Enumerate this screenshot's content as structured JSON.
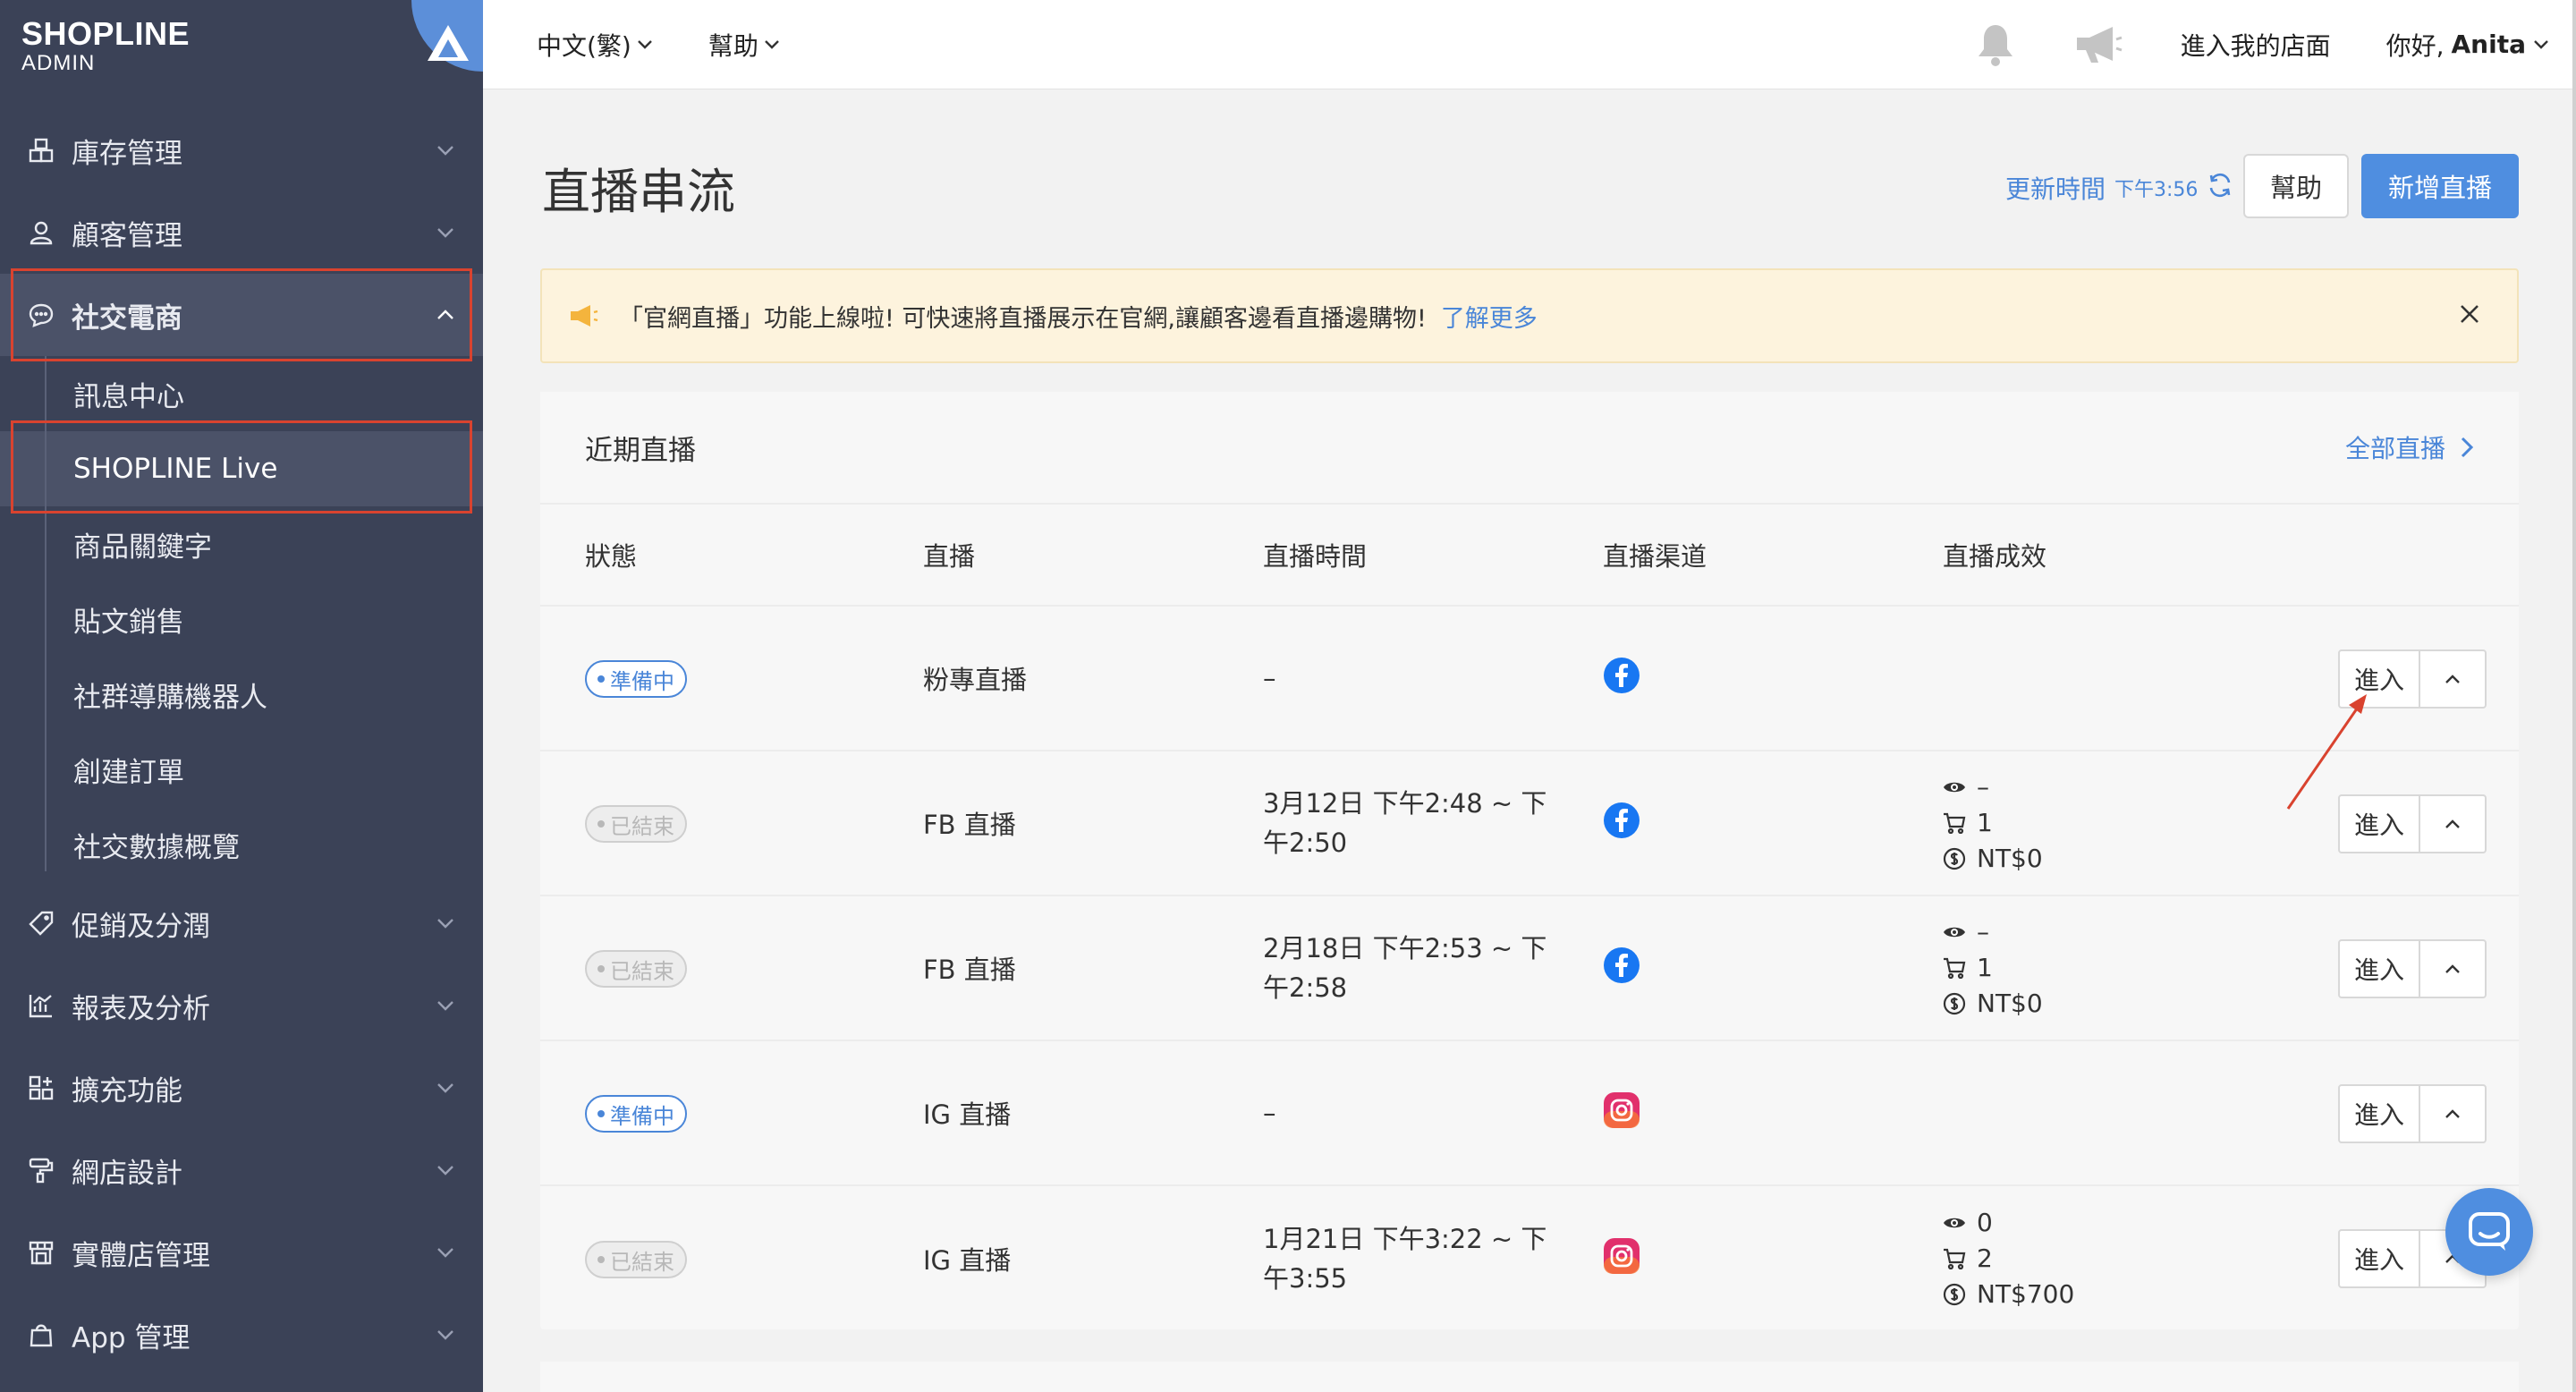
{
  "brand": {
    "name": "SHOPLINE",
    "sub": "ADMIN"
  },
  "sidebar": {
    "items": [
      {
        "label": "庫存管理",
        "icon": "inventory-icon"
      },
      {
        "label": "顧客管理",
        "icon": "user-icon"
      },
      {
        "label": "社交電商",
        "icon": "chat-icon",
        "expanded": true
      },
      {
        "label": "促銷及分潤",
        "icon": "tag-icon"
      },
      {
        "label": "報表及分析",
        "icon": "chart-icon"
      },
      {
        "label": "擴充功能",
        "icon": "apps-icon"
      },
      {
        "label": "網店設計",
        "icon": "paint-roller-icon"
      },
      {
        "label": "實體店管理",
        "icon": "store-icon"
      },
      {
        "label": "App 管理",
        "icon": "bag-icon"
      }
    ],
    "subitems": [
      {
        "label": "訊息中心"
      },
      {
        "label": "SHOPLINE Live",
        "selected": true
      },
      {
        "label": "商品關鍵字"
      },
      {
        "label": "貼文銷售"
      },
      {
        "label": "社群導購機器人"
      },
      {
        "label": "創建訂單"
      },
      {
        "label": "社交數據概覽"
      }
    ]
  },
  "topbar": {
    "language": "中文(繁)",
    "help": "幫助",
    "store_link": "進入我的店面",
    "greeting": "你好,",
    "username": "Anita"
  },
  "page": {
    "title": "直播串流",
    "updated_label": "更新時間",
    "updated_time": "下午3:56",
    "help_button": "幫助",
    "new_button": "新增直播"
  },
  "banner": {
    "text": "「官網直播」功能上線啦! 可快速將直播展示在官網,讓顧客邊看直播邊購物!",
    "link": "了解更多"
  },
  "recent": {
    "title": "近期直播",
    "view_all": "全部直播",
    "columns": [
      "狀態",
      "直播",
      "直播時間",
      "直播渠道",
      "直播成效"
    ],
    "rows": [
      {
        "status": "準備中",
        "status_type": "ready",
        "name": "粉專直播",
        "time": "–",
        "channel": "facebook",
        "views": "",
        "carts": "",
        "revenue": "",
        "enter": "進入"
      },
      {
        "status": "已結束",
        "status_type": "ended",
        "name": "FB 直播",
        "time": "3月12日 下午2:48 ~ 下午2:50",
        "channel": "facebook",
        "views": "–",
        "carts": "1",
        "revenue": "NT$0",
        "enter": "進入"
      },
      {
        "status": "已結束",
        "status_type": "ended",
        "name": "FB 直播",
        "time": "2月18日 下午2:53 ~ 下午2:58",
        "channel": "facebook",
        "views": "–",
        "carts": "1",
        "revenue": "NT$0",
        "enter": "進入"
      },
      {
        "status": "準備中",
        "status_type": "ready",
        "name": "IG 直播",
        "time": "–",
        "channel": "instagram",
        "views": "",
        "carts": "",
        "revenue": "",
        "enter": "進入"
      },
      {
        "status": "已結束",
        "status_type": "ended",
        "name": "IG 直播",
        "time": "1月21日 下午3:22 ~ 下午3:55",
        "channel": "instagram",
        "views": "0",
        "carts": "2",
        "revenue": "NT$700",
        "enter": "進入"
      }
    ]
  },
  "colors": {
    "sidebar_bg": "#3b4257",
    "accent": "#4f8ee0",
    "highlight_box": "#d9432f",
    "banner_bg": "#fdf3dd"
  }
}
